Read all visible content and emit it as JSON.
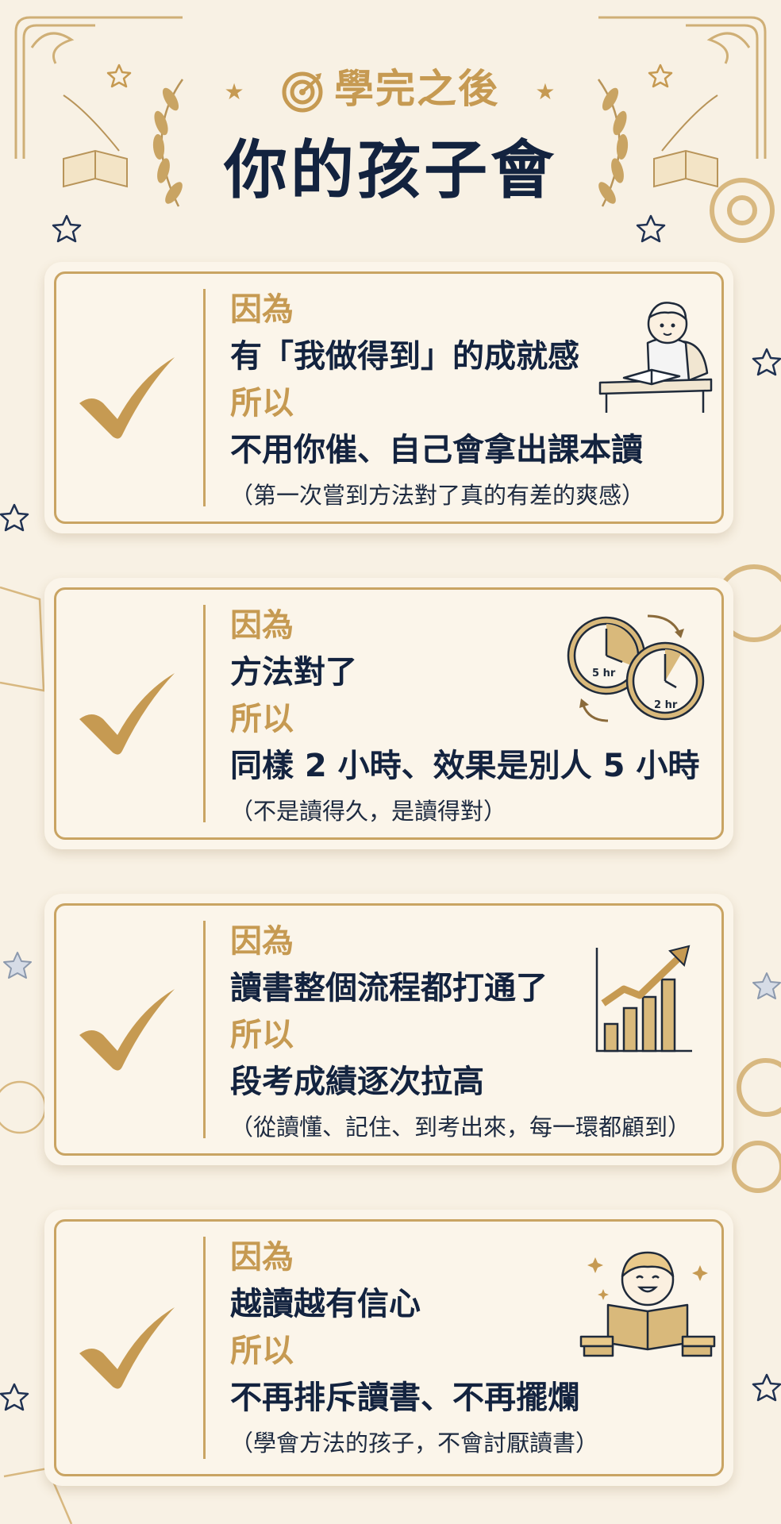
{
  "header": {
    "eyebrow": "學完之後",
    "title": "你的孩子會"
  },
  "cards": [
    {
      "because_label": "因為",
      "reason": "有「我做得到」的成就感",
      "so_label": "所以",
      "result": "不用你催、自己會拿出課本讀",
      "note": "（第一次嘗到方法對了真的有差的爽感）",
      "illustration": "boy-reading-at-desk"
    },
    {
      "because_label": "因為",
      "reason": "方法對了",
      "so_label": "所以",
      "result": "同樣 2 小時、效果是別人 5 小時",
      "note": "（不是讀得久，是讀得對）",
      "illustration": "clocks",
      "clock_labels": [
        "5 hr",
        "2 hr"
      ]
    },
    {
      "because_label": "因為",
      "reason": "讀書整個流程都打通了",
      "so_label": "所以",
      "result": "段考成績逐次拉高",
      "note": "（從讀懂、記住、到考出來，每一環都顧到）",
      "illustration": "rising-bar-chart"
    },
    {
      "because_label": "因為",
      "reason": "越讀越有信心",
      "so_label": "所以",
      "result": "不再排斥讀書、不再擺爛",
      "note": "（學會方法的孩子，不會討厭讀書）",
      "illustration": "happy-boy-with-book"
    }
  ],
  "colors": {
    "background": "#f8f1e4",
    "gold": "#c69a52",
    "navy": "#13233f",
    "card": "#fbf5ea"
  }
}
